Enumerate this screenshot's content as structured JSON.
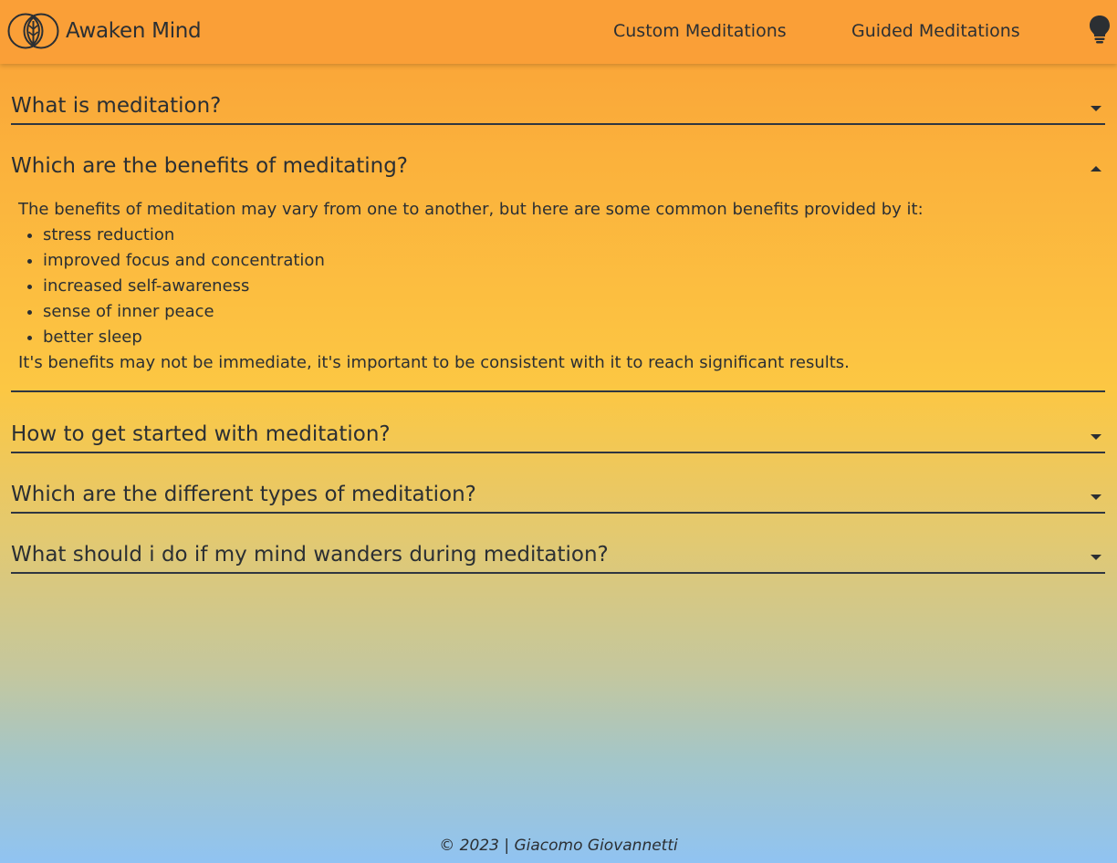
{
  "navbar": {
    "brand": "Awaken Mind",
    "links": [
      "Custom Meditations",
      "Guided Meditations"
    ],
    "theme_icon": "lightbulb-icon",
    "background": "#fa9f37"
  },
  "faq": [
    {
      "question": "What is meditation?",
      "expanded": false
    },
    {
      "question": "Which are the benefits of meditating?",
      "expanded": true,
      "intro": "The benefits of meditation may vary from one to another, but here are some common benefits provided by it:",
      "benefits": [
        "stress reduction",
        "improved focus and concentration",
        "increased self-awareness",
        "sense of inner peace",
        "better sleep"
      ],
      "outro": "It's benefits may not be immediate, it's important to be consistent with it to reach significant results."
    },
    {
      "question": "How to get started with meditation?",
      "expanded": false
    },
    {
      "question": "Which are the different types of meditation?",
      "expanded": false
    },
    {
      "question": "What should i do if my mind wanders during meditation?",
      "expanded": false
    }
  ],
  "footer": {
    "text": "© 2023 | Giacomo Giovannetti"
  },
  "colors": {
    "text": "#2b2f33",
    "gradient_top": "#f99f36",
    "gradient_mid": "#fcc743",
    "gradient_bottom": "#90c3f2"
  }
}
